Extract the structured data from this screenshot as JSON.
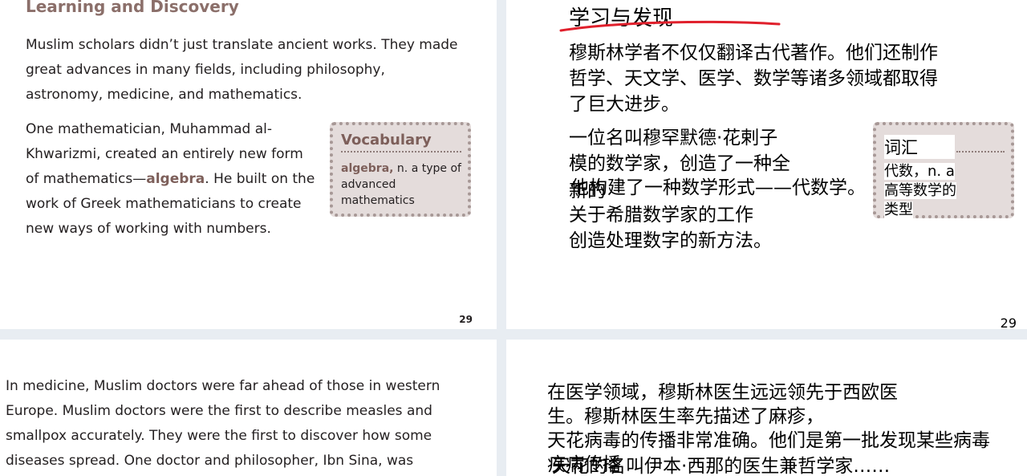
{
  "top_left": {
    "heading": "Learning and Discovery",
    "para1": "Muslim scholars didn’t just translate ancient works. They made great advances in many fields, including philosophy, astronomy, medicine, and mathematics.",
    "para2_before": "One mathematician, Muhammad al-Khwarizmi, created an entirely new form of mathematics—",
    "para2_keyword": "algebra",
    "para2_after": ". He built on the work of Greek mathematicians to create new ways of working with numbers.",
    "vocab": {
      "title": "Vocabulary",
      "term": "algebra,",
      "definition": " n. a type of advanced mathematics"
    },
    "page_number": "29"
  },
  "top_right": {
    "heading": "学习与发现",
    "para1_line1": "穆斯林学者不仅仅翻译古代著作。他们还制作",
    "para1_line2": "哲学、天文学、医学、数学等诸多领域都取得",
    "para1_line3": "了巨大进步。",
    "para2_line1": "一位名叫穆罕默德·花剌子",
    "para2_line2": "模的数学家，创造了一种全",
    "para2_line3a": "新的",
    "para2_line3b": "他构建了一种数学形式——代数学。",
    "para2_line4": "关于希腊数学家的工作",
    "para2_line5": "创造处理数字的新方法。",
    "vocab": {
      "title": "词汇",
      "line1": "代数，n. a",
      "line2": "高等数学的",
      "line3": "类型"
    },
    "page_number": "29"
  },
  "bottom_left": {
    "line1": "In medicine, Muslim doctors were far ahead of those in western",
    "line2": "Europe. Muslim doctors were the first to describe measles and",
    "line3": "smallpox accurately. They were the first to discover how some",
    "line4": "diseases spread. One doctor and philosopher, Ibn Sina, was"
  },
  "bottom_right": {
    "line1": "在医学领域，穆斯林医生远远领先于西欧医",
    "line2": "生。穆斯林医生率先描述了麻疹，",
    "line3": "天花病毒的传播非常准确。他们是第一批发现某些病毒",
    "line4a": "疾病传播",
    "line4b": "天花的名叫伊本·西那的医生兼哲学家……"
  },
  "colors": {
    "heading_brown": "#8b6f6a",
    "vocab_bg": "#e4dcdb",
    "annotation_red": "#e0202c"
  }
}
